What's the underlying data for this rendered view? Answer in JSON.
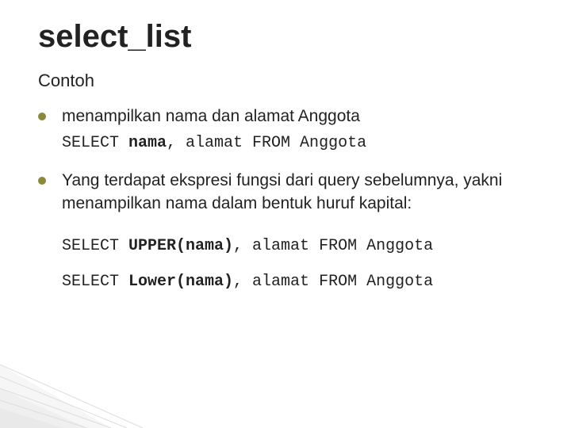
{
  "title": "select_list",
  "subtitle": "Contoh",
  "bullets": [
    {
      "text": "menampilkan nama dan alamat Anggota",
      "code": "SELECT nama, alamat FROM Anggota",
      "code_bold": "nama"
    },
    {
      "text": "Yang terdapat ekspresi fungsi dari query sebelumnya, yakni menampilkan nama dalam bentuk huruf kapital:",
      "codes": [
        {
          "prefix": "SELECT ",
          "bold": "UPPER(nama)",
          "suffix": ", alamat FROM Anggota"
        },
        {
          "prefix": "SELECT ",
          "bold": "Lower(nama)",
          "suffix": ", alamat FROM Anggota"
        }
      ]
    }
  ]
}
